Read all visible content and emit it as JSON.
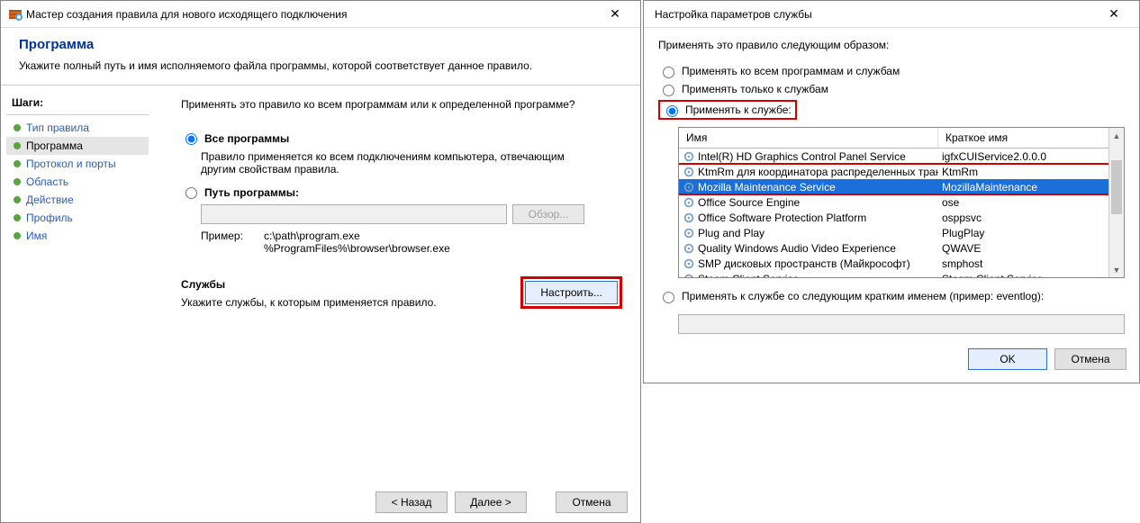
{
  "left": {
    "title": "Мастер создания правила для нового исходящего подключения",
    "heading": "Программа",
    "subheading": "Укажите полный путь и имя исполняемого файла программы, которой соответствует данное правило.",
    "steps_label": "Шаги:",
    "steps": [
      {
        "label": "Тип правила"
      },
      {
        "label": "Программа"
      },
      {
        "label": "Протокол и порты"
      },
      {
        "label": "Область"
      },
      {
        "label": "Действие"
      },
      {
        "label": "Профиль"
      },
      {
        "label": "Имя"
      }
    ],
    "active_step_index": 1,
    "question": "Применять это правило ко всем программам или к определенной программе?",
    "opt_all": "Все программы",
    "opt_all_desc": "Правило применяется ко всем подключениям компьютера, отвечающим другим свойствам правила.",
    "opt_path": "Путь программы:",
    "browse": "Обзор...",
    "example_label": "Пример:",
    "example_text": "c:\\path\\program.exe\n%ProgramFiles%\\browser\\browser.exe",
    "services_label": "Службы",
    "services_desc": "Укажите службы, к которым применяется правило.",
    "configure": "Настроить...",
    "selected_scope": "all",
    "buttons": {
      "back": "< Назад",
      "next": "Далее >",
      "cancel": "Отмена"
    }
  },
  "right": {
    "title": "Настройка параметров службы",
    "intro": "Применять это правило следующим образом:",
    "opt_all": "Применять ко всем программам и службам",
    "opt_services_only": "Применять только к службам",
    "opt_service": "Применять к службе:",
    "opt_shortname": "Применять к службе со следующим кратким именем (пример: eventlog):",
    "selected_mode": "service",
    "columns": {
      "name": "Имя",
      "shortname": "Краткое имя"
    },
    "services": [
      {
        "name": "Intel(R) HD Graphics Control Panel Service",
        "short": "igfxCUIService2.0.0.0"
      },
      {
        "name": "KtmRm для координатора распределенных транза",
        "short": "KtmRm"
      },
      {
        "name": "Mozilla Maintenance Service",
        "short": "MozillaMaintenance"
      },
      {
        "name": "Office  Source Engine",
        "short": "ose"
      },
      {
        "name": "Office Software Protection Platform",
        "short": "osppsvc"
      },
      {
        "name": "Plug and Play",
        "short": "PlugPlay"
      },
      {
        "name": "Quality Windows Audio Video Experience",
        "short": "QWAVE"
      },
      {
        "name": "SMP дисковых пространств (Майкрософт)",
        "short": "smphost"
      },
      {
        "name": "Steam Client Service",
        "short": "Steam Client Service"
      }
    ],
    "selected_service_index": 2,
    "buttons": {
      "ok": "OK",
      "cancel": "Отмена"
    }
  }
}
